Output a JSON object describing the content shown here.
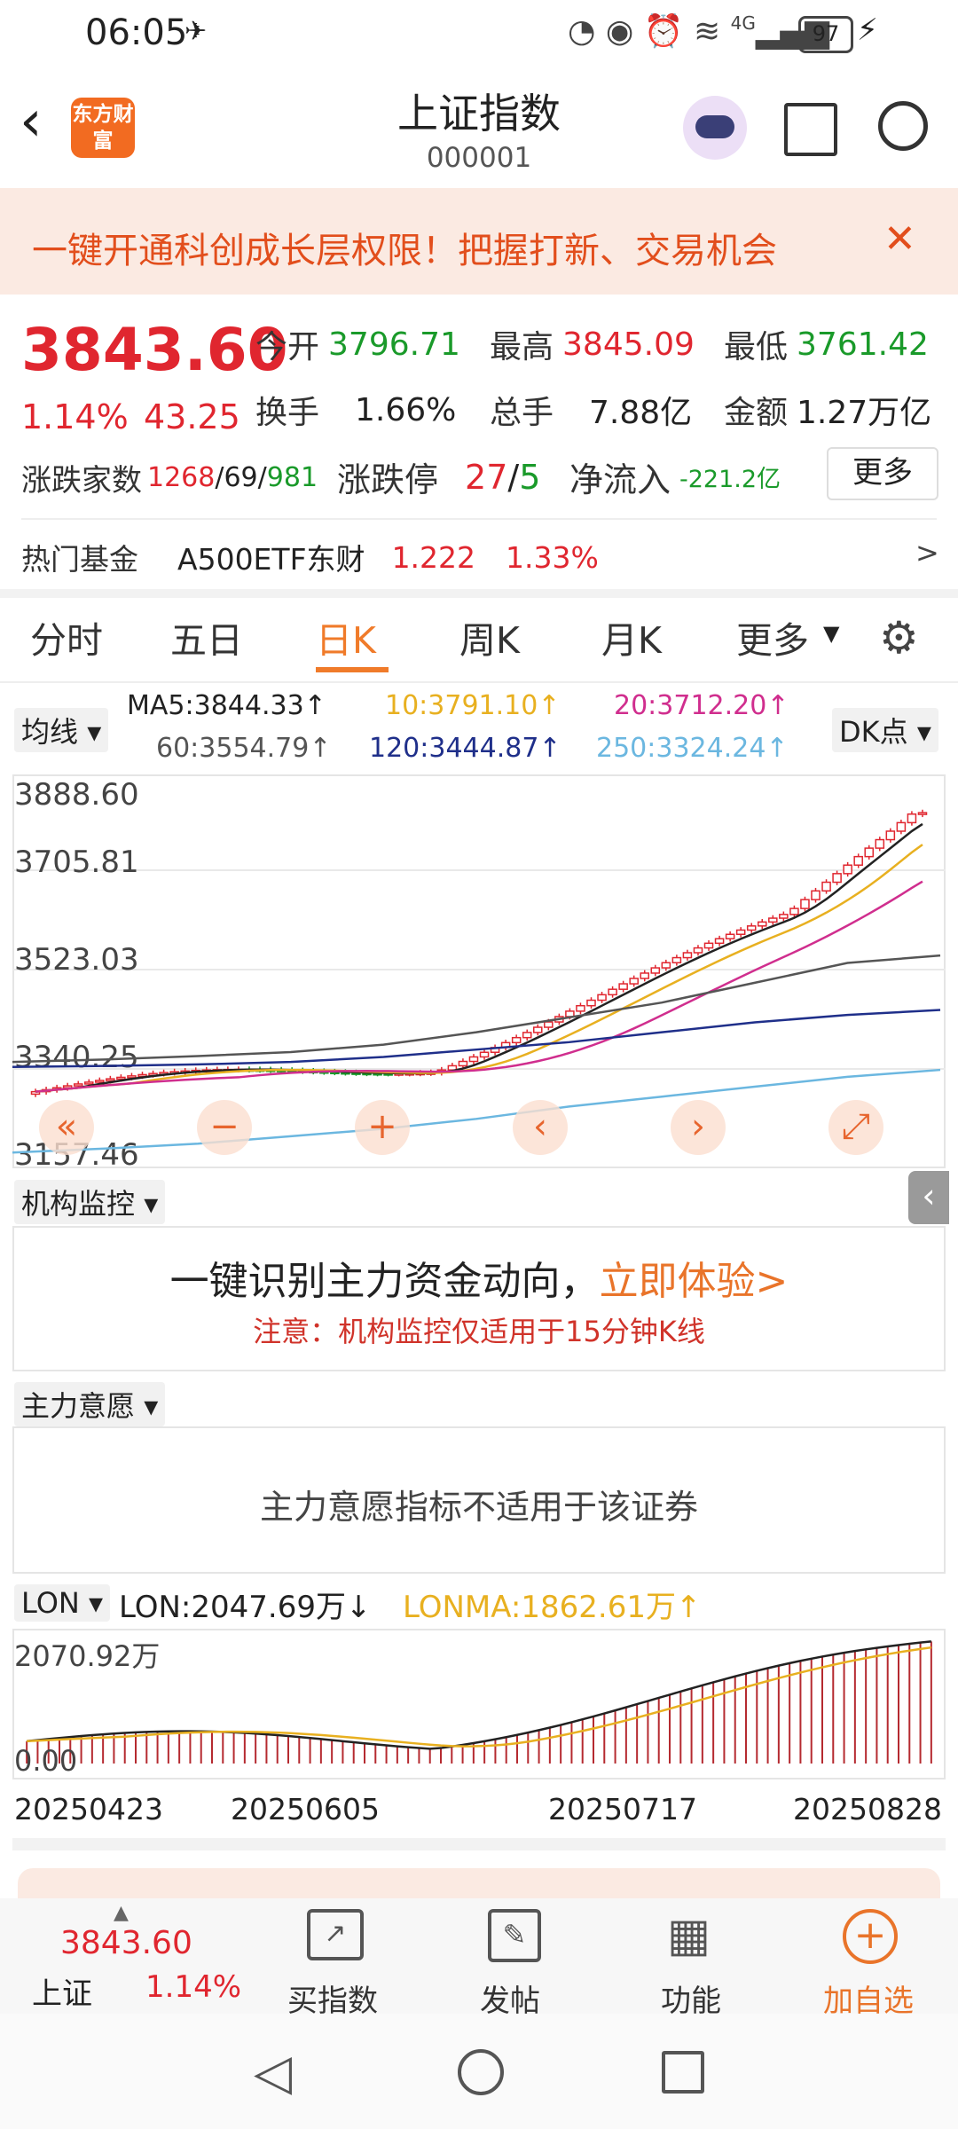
{
  "status_bar": {
    "time": "06:05",
    "battery": "97",
    "network": "4G"
  },
  "header": {
    "logo_text": "东方财富",
    "title": "上证指数",
    "code": "000001"
  },
  "banner": {
    "text": "一键开通科创成长层权限！把握打新、交易机会"
  },
  "quote": {
    "price": "3843.60",
    "change_pct": "1.14%",
    "change": "43.25",
    "open_label": "今开",
    "open": "3796.71",
    "high_label": "最高",
    "high": "3845.09",
    "low_label": "最低",
    "low": "3761.42",
    "turnover_label": "换手",
    "turnover": "1.66%",
    "volume_label": "总手",
    "volume": "7.88亿",
    "amount_label": "金额",
    "amount": "1.27万亿",
    "breadth_label": "涨跌家数",
    "breadth_up": "1268",
    "breadth_flat": "69",
    "breadth_down": "981",
    "limit_label": "涨跌停",
    "limit_up": "27",
    "limit_down": "5",
    "netflow_label": "净流入",
    "netflow": "-221.2亿",
    "more_button": "更多",
    "hot_fund_label": "热门基金",
    "hot_fund_name": "A500ETF东财",
    "hot_fund_price": "1.222",
    "hot_fund_pct": "1.33%"
  },
  "tabs": [
    "分时",
    "五日",
    "日K",
    "周K",
    "月K",
    "更多"
  ],
  "active_tab": "日K",
  "ma": {
    "dropdown": "均线",
    "ma5": "MA5:3844.33↑",
    "ma10": "10:3791.10↑",
    "ma20": "20:3712.20↑",
    "ma60": "60:3554.79↑",
    "ma120": "120:3444.87↑",
    "ma250": "250:3324.24↑",
    "dk_button": "DK点"
  },
  "kline": {
    "y_labels": [
      "3888.60",
      "3705.81",
      "3523.03",
      "3340.25",
      "3157.46"
    ],
    "colors": {
      "up": "#e0262f",
      "down": "#1a9a2a",
      "ma5": "#222222",
      "ma10": "#e8b020",
      "ma20": "#d02e8e",
      "ma60": "#555555",
      "ma120": "#1f2f8a",
      "ma250": "#6bb7e0"
    }
  },
  "panel1": {
    "dropdown": "机构监控",
    "headline_a": "一键识别主力资金动向，",
    "headline_b": "立即体验>",
    "note": "注意：机构监控仅适用于15分钟K线"
  },
  "panel2": {
    "dropdown": "主力意愿",
    "text": "主力意愿指标不适用于该证券"
  },
  "lon": {
    "dropdown": "LON",
    "lon_value": "LON:2047.69万↓",
    "lonma_value": "LONMA:1862.61万↑",
    "y_top": "2070.92万",
    "y_bottom": "0.00",
    "dates": [
      "20250423",
      "20250605",
      "20250717",
      "20250828"
    ]
  },
  "bottom_quote": {
    "name": "上证",
    "price": "3843.60",
    "pct": "1.14%"
  },
  "bottom_actions": [
    "买指数",
    "发帖",
    "功能",
    "加自选"
  ],
  "chart_data": {
    "type": "line",
    "title": "",
    "series": [
      {
        "name": "MA60",
        "values": [
          3340,
          3345,
          3352,
          3360,
          3375,
          3400,
          3430,
          3460,
          3500,
          3540,
          3555
        ]
      },
      {
        "name": "MA120",
        "values": [
          3330,
          3332,
          3335,
          3340,
          3350,
          3365,
          3380,
          3400,
          3420,
          3435,
          3445
        ]
      },
      {
        "name": "MA250",
        "values": [
          3157,
          3165,
          3175,
          3190,
          3205,
          3225,
          3250,
          3270,
          3290,
          3310,
          3324
        ]
      }
    ],
    "ylim": [
      3157.46,
      3888.6
    ]
  }
}
